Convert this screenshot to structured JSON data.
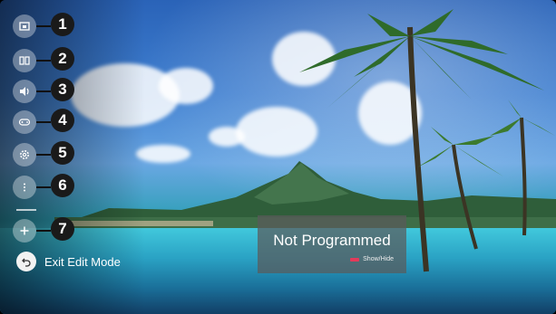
{
  "menu": {
    "items": [
      {
        "icon": "input-icon",
        "number": "1"
      },
      {
        "icon": "guide-icon",
        "number": "2"
      },
      {
        "icon": "sound-icon",
        "number": "3"
      },
      {
        "icon": "game-icon",
        "number": "4"
      },
      {
        "icon": "settings-icon",
        "number": "5"
      },
      {
        "icon": "more-icon",
        "number": "6"
      },
      {
        "icon": "add-icon",
        "number": "7"
      }
    ]
  },
  "exit": {
    "label": "Exit Edit Mode"
  },
  "overlay": {
    "title": "Not Programmed",
    "hint": "Show/Hide",
    "hint_key_color": "#e23a5a"
  }
}
